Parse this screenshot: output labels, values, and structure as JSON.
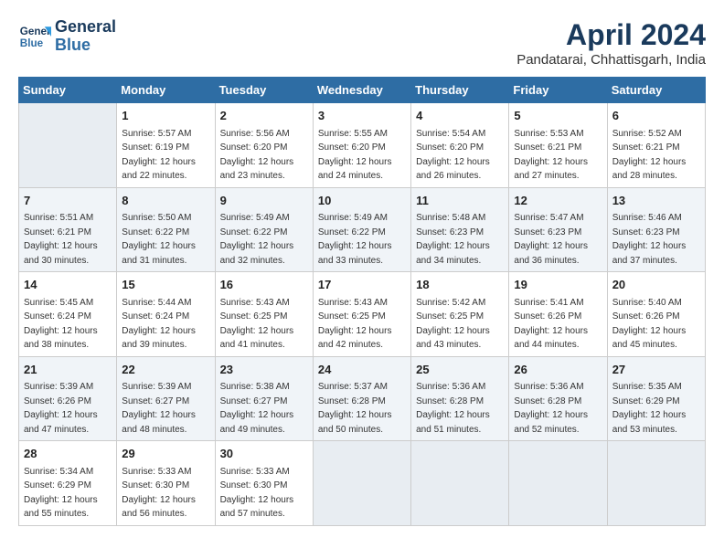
{
  "header": {
    "logo_line1": "General",
    "logo_line2": "Blue",
    "title": "April 2024",
    "location": "Pandatarai, Chhattisgarh, India"
  },
  "weekdays": [
    "Sunday",
    "Monday",
    "Tuesday",
    "Wednesday",
    "Thursday",
    "Friday",
    "Saturday"
  ],
  "weeks": [
    [
      {
        "day": "",
        "empty": true
      },
      {
        "day": "1",
        "sunrise": "5:57 AM",
        "sunset": "6:19 PM",
        "daylight": "12 hours and 22 minutes."
      },
      {
        "day": "2",
        "sunrise": "5:56 AM",
        "sunset": "6:20 PM",
        "daylight": "12 hours and 23 minutes."
      },
      {
        "day": "3",
        "sunrise": "5:55 AM",
        "sunset": "6:20 PM",
        "daylight": "12 hours and 24 minutes."
      },
      {
        "day": "4",
        "sunrise": "5:54 AM",
        "sunset": "6:20 PM",
        "daylight": "12 hours and 26 minutes."
      },
      {
        "day": "5",
        "sunrise": "5:53 AM",
        "sunset": "6:21 PM",
        "daylight": "12 hours and 27 minutes."
      },
      {
        "day": "6",
        "sunrise": "5:52 AM",
        "sunset": "6:21 PM",
        "daylight": "12 hours and 28 minutes."
      }
    ],
    [
      {
        "day": "7",
        "sunrise": "5:51 AM",
        "sunset": "6:21 PM",
        "daylight": "12 hours and 30 minutes."
      },
      {
        "day": "8",
        "sunrise": "5:50 AM",
        "sunset": "6:22 PM",
        "daylight": "12 hours and 31 minutes."
      },
      {
        "day": "9",
        "sunrise": "5:49 AM",
        "sunset": "6:22 PM",
        "daylight": "12 hours and 32 minutes."
      },
      {
        "day": "10",
        "sunrise": "5:49 AM",
        "sunset": "6:22 PM",
        "daylight": "12 hours and 33 minutes."
      },
      {
        "day": "11",
        "sunrise": "5:48 AM",
        "sunset": "6:23 PM",
        "daylight": "12 hours and 34 minutes."
      },
      {
        "day": "12",
        "sunrise": "5:47 AM",
        "sunset": "6:23 PM",
        "daylight": "12 hours and 36 minutes."
      },
      {
        "day": "13",
        "sunrise": "5:46 AM",
        "sunset": "6:23 PM",
        "daylight": "12 hours and 37 minutes."
      }
    ],
    [
      {
        "day": "14",
        "sunrise": "5:45 AM",
        "sunset": "6:24 PM",
        "daylight": "12 hours and 38 minutes."
      },
      {
        "day": "15",
        "sunrise": "5:44 AM",
        "sunset": "6:24 PM",
        "daylight": "12 hours and 39 minutes."
      },
      {
        "day": "16",
        "sunrise": "5:43 AM",
        "sunset": "6:25 PM",
        "daylight": "12 hours and 41 minutes."
      },
      {
        "day": "17",
        "sunrise": "5:43 AM",
        "sunset": "6:25 PM",
        "daylight": "12 hours and 42 minutes."
      },
      {
        "day": "18",
        "sunrise": "5:42 AM",
        "sunset": "6:25 PM",
        "daylight": "12 hours and 43 minutes."
      },
      {
        "day": "19",
        "sunrise": "5:41 AM",
        "sunset": "6:26 PM",
        "daylight": "12 hours and 44 minutes."
      },
      {
        "day": "20",
        "sunrise": "5:40 AM",
        "sunset": "6:26 PM",
        "daylight": "12 hours and 45 minutes."
      }
    ],
    [
      {
        "day": "21",
        "sunrise": "5:39 AM",
        "sunset": "6:26 PM",
        "daylight": "12 hours and 47 minutes."
      },
      {
        "day": "22",
        "sunrise": "5:39 AM",
        "sunset": "6:27 PM",
        "daylight": "12 hours and 48 minutes."
      },
      {
        "day": "23",
        "sunrise": "5:38 AM",
        "sunset": "6:27 PM",
        "daylight": "12 hours and 49 minutes."
      },
      {
        "day": "24",
        "sunrise": "5:37 AM",
        "sunset": "6:28 PM",
        "daylight": "12 hours and 50 minutes."
      },
      {
        "day": "25",
        "sunrise": "5:36 AM",
        "sunset": "6:28 PM",
        "daylight": "12 hours and 51 minutes."
      },
      {
        "day": "26",
        "sunrise": "5:36 AM",
        "sunset": "6:28 PM",
        "daylight": "12 hours and 52 minutes."
      },
      {
        "day": "27",
        "sunrise": "5:35 AM",
        "sunset": "6:29 PM",
        "daylight": "12 hours and 53 minutes."
      }
    ],
    [
      {
        "day": "28",
        "sunrise": "5:34 AM",
        "sunset": "6:29 PM",
        "daylight": "12 hours and 55 minutes."
      },
      {
        "day": "29",
        "sunrise": "5:33 AM",
        "sunset": "6:30 PM",
        "daylight": "12 hours and 56 minutes."
      },
      {
        "day": "30",
        "sunrise": "5:33 AM",
        "sunset": "6:30 PM",
        "daylight": "12 hours and 57 minutes."
      },
      {
        "day": "",
        "empty": true
      },
      {
        "day": "",
        "empty": true
      },
      {
        "day": "",
        "empty": true
      },
      {
        "day": "",
        "empty": true
      }
    ]
  ],
  "labels": {
    "sunrise": "Sunrise:",
    "sunset": "Sunset:",
    "daylight": "Daylight:"
  }
}
